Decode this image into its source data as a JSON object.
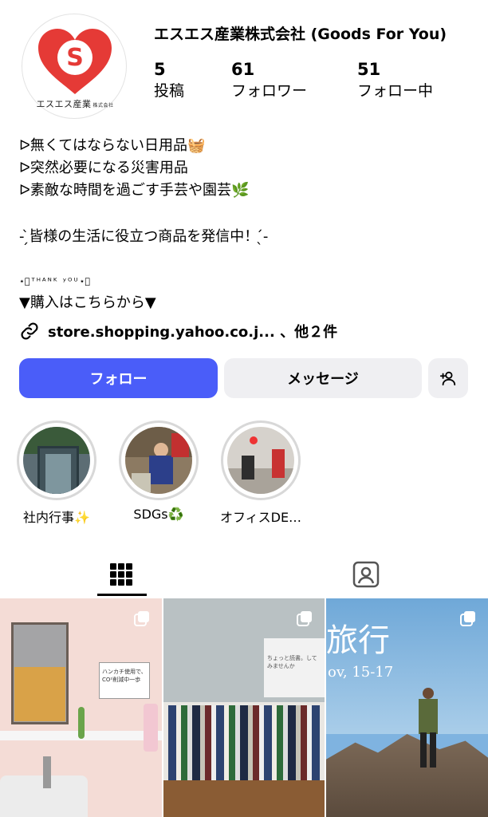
{
  "profile": {
    "name": "エスエス産業株式会社 (Goods For You)",
    "avatar_letter": "S",
    "avatar_caption": "エスエス産業",
    "avatar_caption_small": "株式会社"
  },
  "stats": {
    "posts": {
      "count": "5",
      "label": "投稿"
    },
    "followers": {
      "count": "61",
      "label": "フォロワー"
    },
    "following": {
      "count": "51",
      "label": "フォロー中"
    }
  },
  "bio": {
    "line1": "ᐅ無くてはならない日用品🧺",
    "line2": "ᐅ突然必要になる災害用品",
    "line3": "ᐅ素敵な時間を過ごす手芸や園芸🌿",
    "line4": "- ̗̀皆様の生活に役立つ商品を発信中！ ̖́-",
    "line5": "⋆͛ᵀᴴᴬᴺᴷ ʸᴼᵁ⋆͛",
    "line6": "▼購入はこちらから▼",
    "link": "store.shopping.yahoo.co.j... 、他２件"
  },
  "actions": {
    "follow_label": "フォロー",
    "message_label": "メッセージ",
    "suggest_icon": "person-add-icon"
  },
  "highlights": [
    {
      "label": "社内行事✨"
    },
    {
      "label": "SDGs♻️"
    },
    {
      "label": "オフィスDE…"
    }
  ],
  "tabs": {
    "grid_icon": "grid-icon",
    "tagged_icon": "tagged-person-icon"
  },
  "posts": [
    {
      "text1": "ハンカチ使用で、",
      "text2": "CO²削減中一歩"
    },
    {
      "text": "ちょっと読書。してみませんか"
    },
    {
      "title": "旅行",
      "date": "ov, 15-17"
    }
  ],
  "colors": {
    "follow_button": "#4a5df9",
    "secondary_button": "#efeff2",
    "brand_red": "#e53a36"
  }
}
